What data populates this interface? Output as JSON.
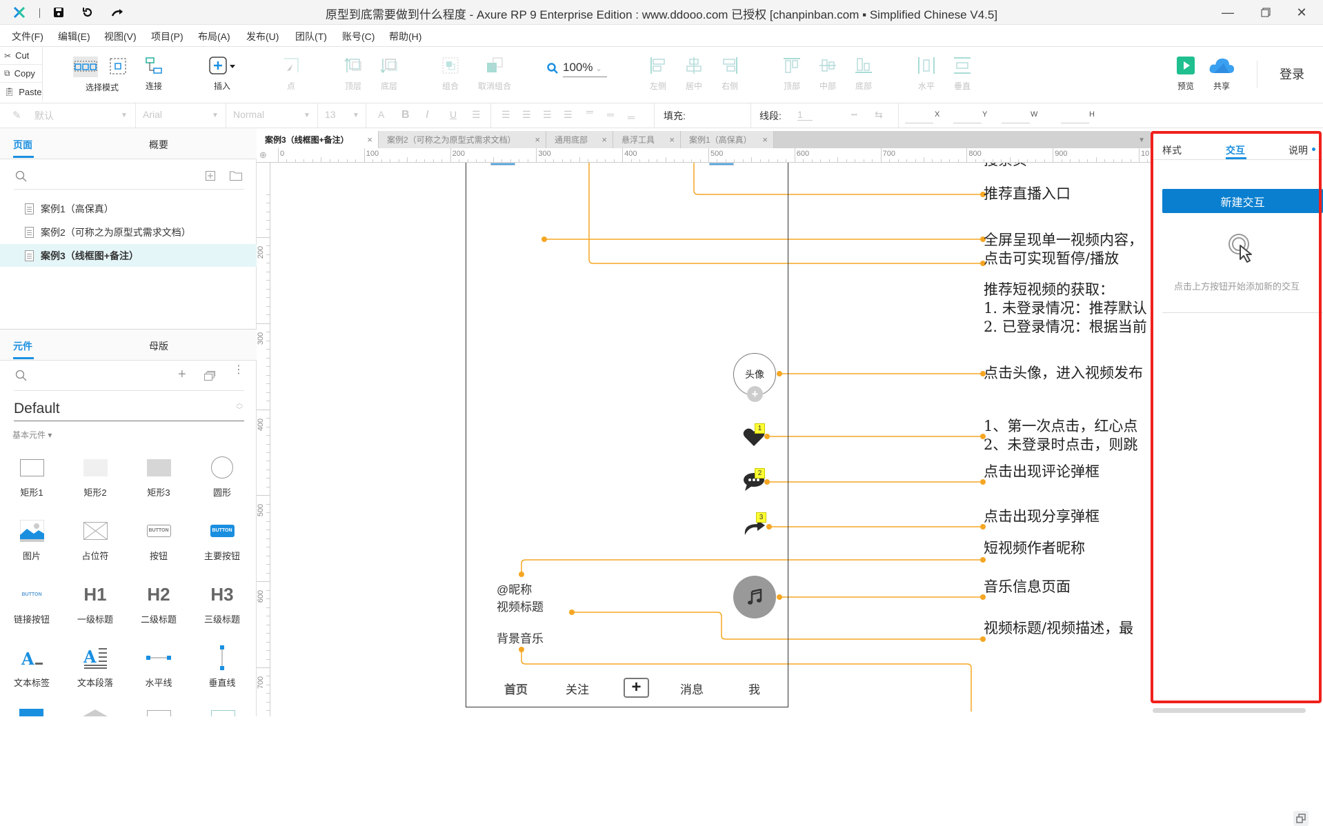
{
  "app": {
    "title": "原型到底需要做到什么程度 - Axure RP 9 Enterprise Edition : www.ddooo.com 已授权    [chanpinban.com ▪ Simplified Chinese V4.5]"
  },
  "menu": [
    "文件(F)",
    "编辑(E)",
    "视图(V)",
    "项目(P)",
    "布局(A)",
    "发布(U)",
    "团队(T)",
    "账号(C)",
    "帮助(H)"
  ],
  "clipboard": {
    "cut": "Cut",
    "copy": "Copy",
    "paste": "Paste"
  },
  "toolbar": {
    "select_mode": "选择模式",
    "connect": "连接",
    "insert": "插入",
    "point": "点",
    "top_layer": "顶层",
    "bottom_layer": "底层",
    "group": "组合",
    "ungroup": "取消组合",
    "zoom": "100%",
    "align_left": "左侧",
    "align_center": "居中",
    "align_right": "右侧",
    "align_top": "顶部",
    "align_middle": "中部",
    "align_bottom": "底部",
    "dist_horizontal": "水平",
    "dist_vertical": "垂直",
    "preview": "预览",
    "share": "共享",
    "login": "登录"
  },
  "formatbar": {
    "style": "默认",
    "font": "Arial",
    "weight": "Normal",
    "size": "13",
    "fill_label": "填充:",
    "line_label": "线段:",
    "line_value": "1",
    "x_label": "X",
    "y_label": "Y",
    "w_label": "W",
    "h_label": "H"
  },
  "pages_panel": {
    "tabs": [
      "页面",
      "概要"
    ],
    "active_tab": "页面",
    "pages": [
      {
        "label": "案例1（高保真）",
        "selected": false
      },
      {
        "label": "案例2（可称之为原型式需求文档）",
        "selected": false
      },
      {
        "label": "案例3（线框图+备注）",
        "selected": true
      }
    ]
  },
  "widgets_panel": {
    "tabs": [
      "元件",
      "母版"
    ],
    "active_tab": "元件",
    "library": "Default",
    "category": "基本元件 ▾",
    "widgets": [
      "矩形1",
      "矩形2",
      "矩形3",
      "圆形",
      "图片",
      "占位符",
      "按钮",
      "主要按钮",
      "链接按钮",
      "一级标题",
      "二级标题",
      "三级标题",
      "文本标签",
      "文本段落",
      "水平线",
      "垂直线"
    ],
    "button_text": "BUTTON",
    "h1": "H1",
    "h2": "H2",
    "h3": "H3"
  },
  "doc_tabs": [
    {
      "label": "案例3（线框图+备注）",
      "active": true
    },
    {
      "label": "案例2（可称之为原型式需求文档）",
      "active": false
    },
    {
      "label": "通用底部",
      "active": false
    },
    {
      "label": "悬浮工具",
      "active": false
    },
    {
      "label": "案例1（高保真）",
      "active": false
    }
  ],
  "ruler": {
    "h_ticks": [
      "0",
      "100",
      "200",
      "300",
      "400",
      "500",
      "600",
      "700",
      "800",
      "900",
      "10"
    ],
    "v_ticks": [
      "200",
      "300",
      "400",
      "500",
      "600",
      "700"
    ]
  },
  "phone": {
    "avatar": "头像",
    "badges": [
      "1",
      "2",
      "3"
    ],
    "nickname": "@昵称",
    "video_title": "视频标题",
    "bgm": "背景音乐",
    "nav": [
      "首页",
      "关注",
      "+",
      "消息",
      "我"
    ]
  },
  "annotations": [
    {
      "text": "搜索页"
    },
    {
      "text": "推荐直播入口"
    },
    {
      "text": "全屏呈现单一视频内容，\n点击可实现暂停/播放"
    },
    {
      "text": "推荐短视频的获取：\n1. 未登录情况：推荐默认\n2. 已登录情况：根据当前"
    },
    {
      "text": "点击头像，进入视频发布"
    },
    {
      "text": "1、第一次点击，红心点\n2、未登录时点击，则跳"
    },
    {
      "text": "点击出现评论弹框"
    },
    {
      "text": "点击出现分享弹框"
    },
    {
      "text": "短视频作者昵称"
    },
    {
      "text": "音乐信息页面"
    },
    {
      "text": "视频标题/视频描述，最"
    }
  ],
  "right_panel": {
    "tabs": [
      "样式",
      "交互",
      "说明"
    ],
    "active_tab": "交互",
    "new_interaction": "新建交互",
    "hint": "点击上方按钮开始添加新的交互"
  },
  "colors": {
    "accent": "#1a8fe0",
    "annotation_line": "#f5a623",
    "highlight_box": "#f0201c",
    "preview_green": "#1fbf8f",
    "share_blue": "#3aa0f0",
    "badge_yellow": "#ffff33"
  }
}
